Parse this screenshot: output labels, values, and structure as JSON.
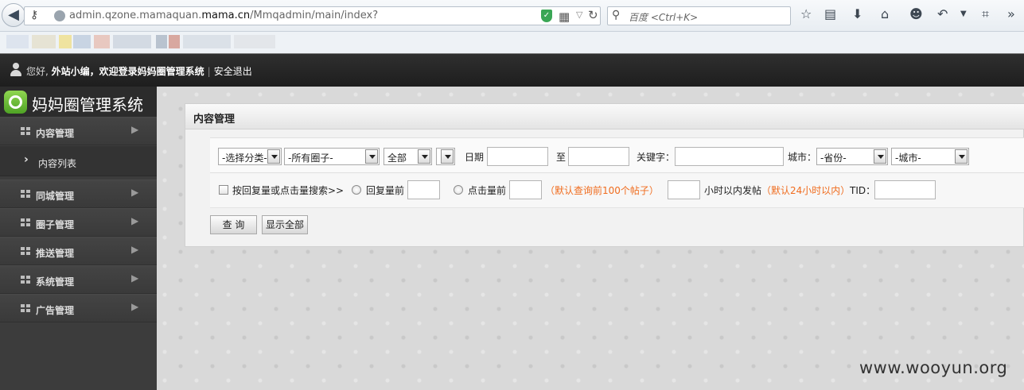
{
  "browser": {
    "back_glyph": "◀",
    "url_prefix": "admin.qzone.mamaquan.",
    "url_domain": "mama.cn",
    "url_path": "/Mmqadmin/main/index?",
    "search_placeholder": "百度 <Ctrl+K>",
    "icons": [
      "key-icon",
      "globe-icon",
      "shield-icon",
      "qr-code-icon",
      "dropdown-icon",
      "reload-icon",
      "search-icon",
      "star-icon",
      "reading-list-icon",
      "download-icon",
      "home-icon",
      "smiley-icon",
      "undo-icon",
      "menu-dropdown-icon",
      "crop-icon",
      "overflow-icon"
    ]
  },
  "header": {
    "greeting": "您好,",
    "username": "外站小编，欢迎登录妈妈圈管理系统",
    "separator": "|",
    "logout": "安全退出"
  },
  "sidebar": {
    "brand": "妈妈圈管理系统",
    "items": [
      {
        "label": "内容管理",
        "expanded": true
      },
      {
        "label": "内容列表",
        "sub": true
      },
      {
        "label": "同城管理"
      },
      {
        "label": "圈子管理"
      },
      {
        "label": "推送管理"
      },
      {
        "label": "系统管理"
      },
      {
        "label": "广告管理"
      }
    ]
  },
  "panel": {
    "title": "内容管理",
    "filters": {
      "category": "-选择分类-",
      "circle": "-所有圈子-",
      "scope": "全部",
      "extra": "",
      "date_label": "日期",
      "date_to_label": "至",
      "keyword_label": "关键字：",
      "city_label": "城市：",
      "province": "-省份-",
      "city": "-城市-"
    },
    "row2": {
      "checkbox_label": "按回复量或点击量搜索>>",
      "reply_label": "回复量前",
      "click_label": "点击量前",
      "click_note": "（默认查询前100个帖子）",
      "hours_label": "小时以内发帖",
      "hours_note": "（默认24小时以内）",
      "tid_label": "TID："
    },
    "buttons": {
      "query": "查 询",
      "show_all": "显示全部"
    }
  },
  "watermark": "www.wooyun.org"
}
